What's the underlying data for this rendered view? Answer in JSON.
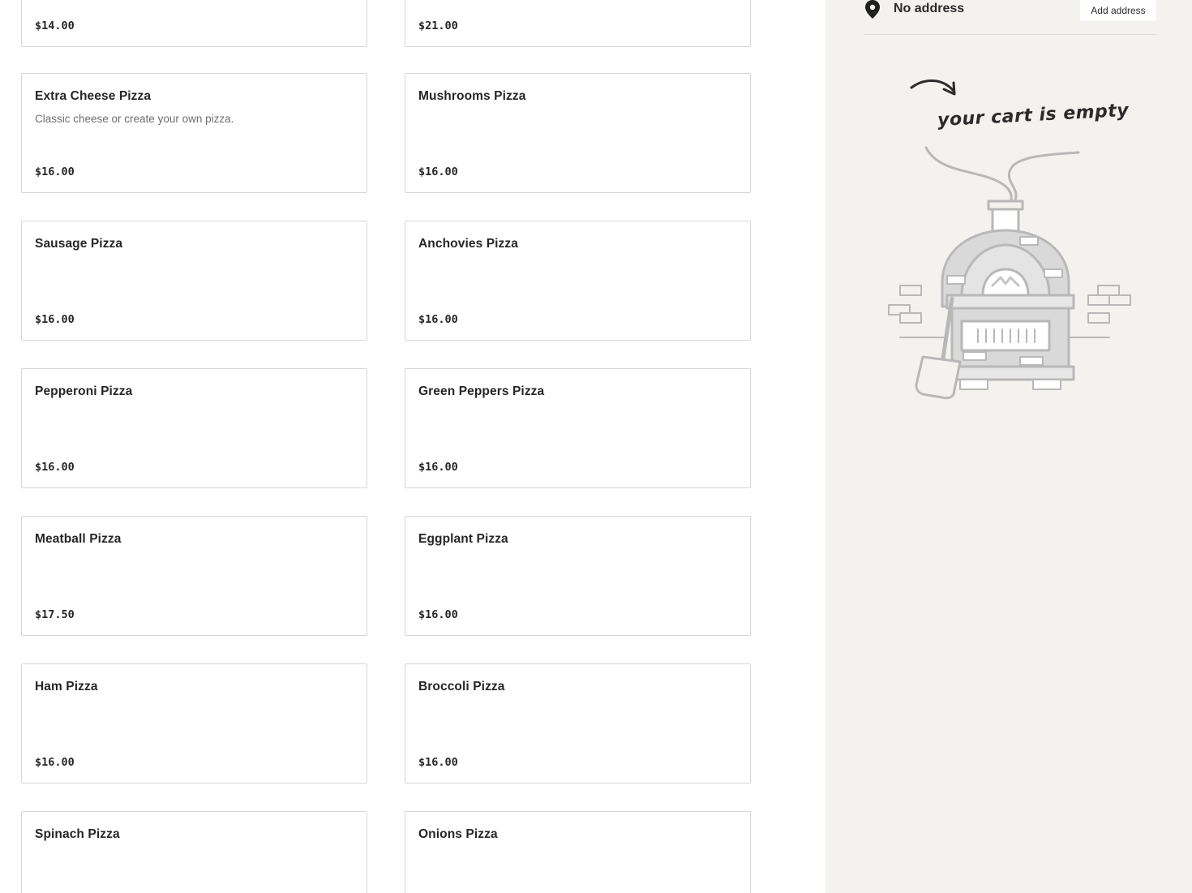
{
  "menu": {
    "items": [
      {
        "name": "",
        "description": "",
        "price": "$14.00"
      },
      {
        "name": "",
        "description": "",
        "price": "$21.00"
      },
      {
        "name": "Extra Cheese Pizza",
        "description": "Classic cheese or create your own pizza.",
        "price": "$16.00"
      },
      {
        "name": "Mushrooms Pizza",
        "description": "",
        "price": "$16.00"
      },
      {
        "name": "Sausage Pizza",
        "description": "",
        "price": "$16.00"
      },
      {
        "name": "Anchovies Pizza",
        "description": "",
        "price": "$16.00"
      },
      {
        "name": "Pepperoni Pizza",
        "description": "",
        "price": "$16.00"
      },
      {
        "name": "Green Peppers Pizza",
        "description": "",
        "price": "$16.00"
      },
      {
        "name": "Meatball Pizza",
        "description": "",
        "price": "$17.50"
      },
      {
        "name": "Eggplant Pizza",
        "description": "",
        "price": "$16.00"
      },
      {
        "name": "Ham Pizza",
        "description": "",
        "price": "$16.00"
      },
      {
        "name": "Broccoli Pizza",
        "description": "",
        "price": "$16.00"
      },
      {
        "name": "Spinach Pizza",
        "description": "",
        "price": ""
      },
      {
        "name": "Onions Pizza",
        "description": "",
        "price": ""
      }
    ]
  },
  "cart": {
    "address_text": "No address",
    "add_address_label": "Add address",
    "empty_text": "your cart is empty",
    "icons": {
      "pin": "map-pin-icon",
      "arrow": "curved-arrow-icon",
      "oven": "pizza-oven-illustration"
    }
  },
  "colors": {
    "sidebar_bg": "#f3f2ef",
    "card_border": "#d7d7d7",
    "text_primary": "#262626",
    "text_muted": "#6e6e6e"
  }
}
